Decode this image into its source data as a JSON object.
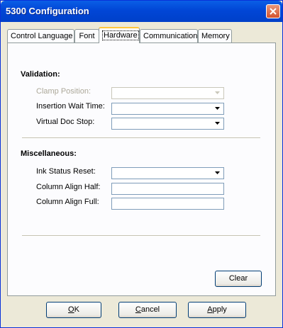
{
  "window": {
    "title": "5300 Configuration"
  },
  "tabs": [
    {
      "label": "Control Language"
    },
    {
      "label": "Font"
    },
    {
      "label": "Hardware",
      "active": true
    },
    {
      "label": "Communication"
    },
    {
      "label": "Memory"
    }
  ],
  "validation": {
    "heading": "Validation:",
    "clamp_position": {
      "label": "Clamp Position:",
      "value": "",
      "disabled": true
    },
    "insertion_wait_time": {
      "label": "Insertion Wait Time:",
      "value": ""
    },
    "virtual_doc_stop": {
      "label": "Virtual Doc Stop:",
      "value": ""
    }
  },
  "miscellaneous": {
    "heading": "Miscellaneous:",
    "ink_status_reset": {
      "label": "Ink Status Reset:",
      "value": ""
    },
    "column_align_half": {
      "label": "Column Align Half:",
      "value": ""
    },
    "column_align_full": {
      "label": "Column Align Full:",
      "value": ""
    }
  },
  "buttons": {
    "clear": "Clear",
    "ok_mnemonic": "O",
    "ok_rest": "K",
    "cancel_mnemonic": "C",
    "cancel_rest": "ancel",
    "apply_mnemonic": "A",
    "apply_rest": "pply"
  },
  "colors": {
    "titlebar": "#0146d6",
    "dialog_bg": "#ece9d8",
    "active_tab_accent": "#ffc73c",
    "close_button": "#d4522e"
  },
  "icons": [
    "close-icon",
    "chevron-down-icon"
  ]
}
